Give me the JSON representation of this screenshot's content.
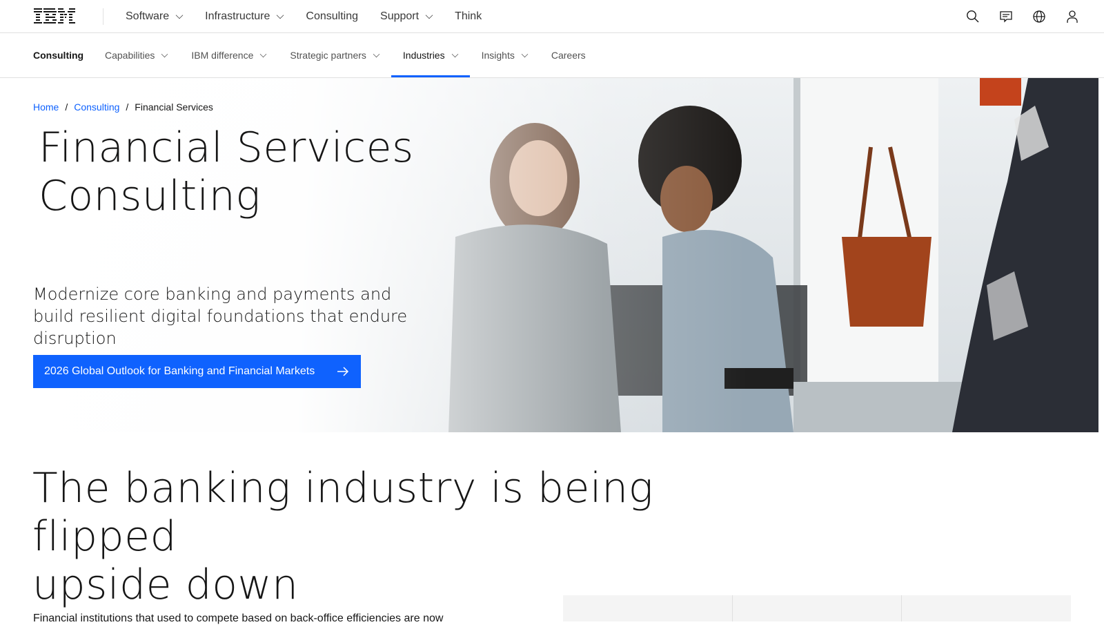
{
  "masthead": {
    "logo_alt": "IBM",
    "nav": [
      {
        "label": "Software",
        "has_menu": true
      },
      {
        "label": "Infrastructure",
        "has_menu": true
      },
      {
        "label": "Consulting",
        "has_menu": false
      },
      {
        "label": "Support",
        "has_menu": true
      },
      {
        "label": "Think",
        "has_menu": false
      }
    ],
    "icons": [
      "search-icon",
      "chat-icon",
      "globe-icon",
      "user-icon"
    ]
  },
  "subnav": {
    "brand": "Consulting",
    "links": [
      {
        "label": "Capabilities",
        "has_menu": true
      },
      {
        "label": "IBM difference",
        "has_menu": true
      },
      {
        "label": "Strategic partners",
        "has_menu": true
      },
      {
        "label": "Industries",
        "has_menu": true,
        "active": true
      },
      {
        "label": "Insights",
        "has_menu": true
      },
      {
        "label": "Careers",
        "has_menu": false
      }
    ]
  },
  "breadcrumb": {
    "home": "Home",
    "consulting": "Consulting",
    "current": "Financial Services",
    "separator": "/"
  },
  "hero": {
    "title_line1": "Financial Services",
    "title_line2": "Consulting",
    "subtitle": "Modernize core banking and payments and build resilient digital foundations that endure disruption",
    "cta_label": "2026 Global Outlook for Banking and Financial Markets"
  },
  "section": {
    "title_line1": "The banking industry is being flipped",
    "title_line2": "upside down",
    "body": "Financial institutions that used to compete based on back-office efficiencies are now"
  },
  "colors": {
    "accent": "#0f62fe",
    "text": "#161616",
    "border": "#e0e0e0"
  }
}
